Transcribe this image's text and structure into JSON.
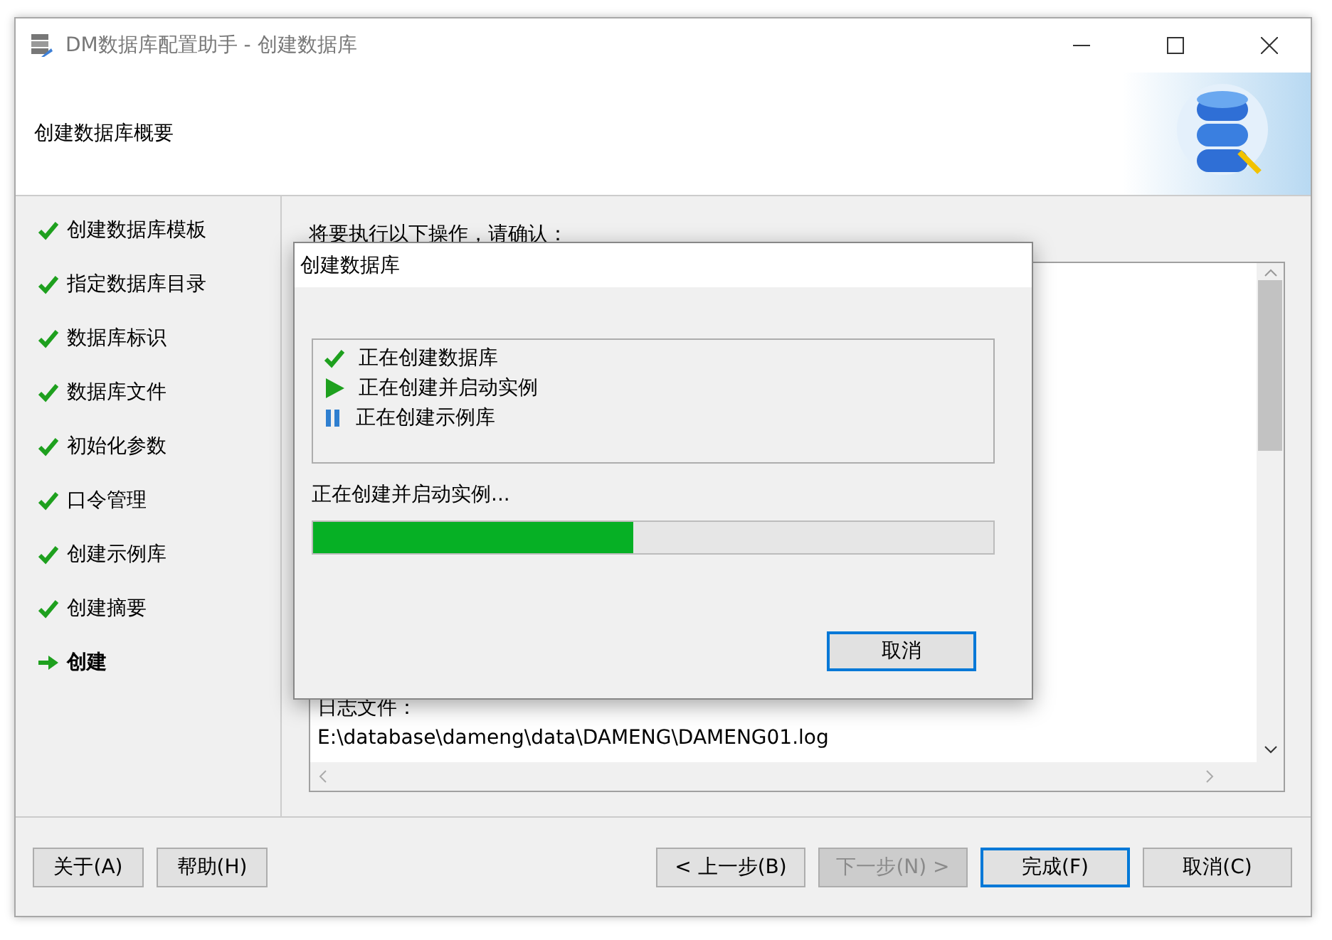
{
  "window": {
    "title": "DM数据库配置助手 - 创建数据库"
  },
  "header": {
    "title": "创建数据库概要"
  },
  "steps": [
    {
      "label": "创建数据库模板",
      "kind": "done",
      "selected": false
    },
    {
      "label": "指定数据库目录",
      "kind": "done",
      "selected": false
    },
    {
      "label": "数据库标识",
      "kind": "done",
      "selected": false
    },
    {
      "label": "数据库文件",
      "kind": "done",
      "selected": false
    },
    {
      "label": "初始化参数",
      "kind": "done",
      "selected": false
    },
    {
      "label": "口令管理",
      "kind": "done",
      "selected": false
    },
    {
      "label": "创建示例库",
      "kind": "done",
      "selected": false
    },
    {
      "label": "创建摘要",
      "kind": "done",
      "selected": false
    },
    {
      "label": "创建",
      "kind": "current",
      "selected": true
    }
  ],
  "summary": {
    "prompt": "将要执行以下操作，请确认：",
    "log_label": "日志文件：",
    "log_path": "E:\\database\\dameng\\data\\DAMENG\\DAMENG01.log"
  },
  "dialog": {
    "title": "创建数据库",
    "tasks": [
      {
        "label": "正在创建数据库",
        "kind": "done"
      },
      {
        "label": "正在创建并启动实例",
        "kind": "running"
      },
      {
        "label": "正在创建示例库",
        "kind": "paused"
      }
    ],
    "status": "正在创建并启动实例...",
    "level": 0.47,
    "cancel": "取消"
  },
  "buttons": [
    {
      "label": "关于(A)",
      "disabled": false,
      "default": false
    },
    {
      "label": "帮助(H)",
      "disabled": false,
      "default": false
    },
    {
      "label": "< 上一步(B)",
      "disabled": false,
      "default": false
    },
    {
      "label": "下一步(N) >",
      "disabled": true,
      "default": false
    },
    {
      "label": "完成(F)",
      "disabled": false,
      "default": true
    },
    {
      "label": "取消(C)",
      "disabled": false,
      "default": false
    }
  ]
}
